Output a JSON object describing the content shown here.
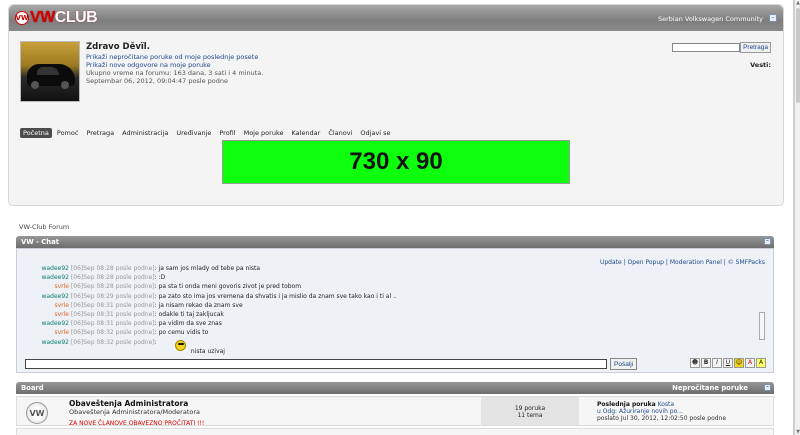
{
  "header": {
    "logo_left": "VW",
    "logo_right": "CLUB",
    "community": "Serbian Volkswagen Community"
  },
  "user": {
    "greeting": "Zdravo Děvïl.",
    "link_unread": "Prikaži nepročitane poruke od moje poslednje posete",
    "link_replies": "Prikaži nove odgovore na moje poruke",
    "time_online": "Ukupno vreme na forumu: 163 dana, 3 sati i 4 minuta.",
    "date": "Septembar 06, 2012, 09:04:47 posle podne"
  },
  "search": {
    "button": "Pretraga",
    "news_label": "Vesti:"
  },
  "menu": [
    "Početna",
    "Pomoć",
    "Pretraga",
    "Administracija",
    "Uređivanje",
    "Profil",
    "Moje poruke",
    "Kalendar",
    "Članovi",
    "Odjavi se"
  ],
  "banner": "730 x 90",
  "breadcrumb": "VW-Club Forum",
  "chat": {
    "title": "VW - Chat",
    "links": "Update | Open Popup | Moderation Panel | © SMFPacks",
    "send": "Pošalji",
    "format_buttons": [
      "☻",
      "B",
      "I",
      "U",
      "☺",
      "A",
      "A"
    ],
    "lines": [
      {
        "nick": "wadee92",
        "color": "teal",
        "ts": "[06]Sep 08:28 posle podne]",
        "msg": ": ja sam jos mlady od tebe pa nista"
      },
      {
        "nick": "wadee92",
        "color": "teal",
        "ts": "[06]Sep 08:28 posle podne]",
        "msg": ": :D"
      },
      {
        "nick": "svrle",
        "color": "orange",
        "ts": "[06]Sep 08:28 posle podne]",
        "msg": ": pa sta ti onda meni govoris zivot je pred tobom"
      },
      {
        "nick": "wadee92",
        "color": "teal",
        "ts": "[06]Sep 08:29 posle podne]",
        "msg": ": pa zato sto ima jos vremena da shvatis i ja mislio da znam sve tako kao i ti al .."
      },
      {
        "nick": "svrle",
        "color": "orange",
        "ts": "[06]Sep 08:31 posle podne]",
        "msg": ": ja nisam rekao da znam sve"
      },
      {
        "nick": "svrle",
        "color": "orange",
        "ts": "[06]Sep 08:31 posle podne]",
        "msg": ": odakle ti taj zakljucak"
      },
      {
        "nick": "wadee92",
        "color": "teal",
        "ts": "[06]Sep 08:31 posle podne]",
        "msg": ": pa vidim da sve znas"
      },
      {
        "nick": "svrle",
        "color": "orange",
        "ts": "[06]Sep 08:32 posle podne]",
        "msg": ": po cemu vidis to"
      },
      {
        "nick": "wadee92",
        "color": "teal",
        "ts": "[06]Sep 08:32 posle podne]",
        "msg": ":"
      },
      {
        "nick": "",
        "color": "teal",
        "ts": "",
        "msg": "nista uzivaj"
      }
    ]
  },
  "board": {
    "title": "Board",
    "unread": "Nepročitane poruke",
    "rows": [
      {
        "icon": "VW",
        "name": "Obaveštenja Administratora",
        "desc": "Obaveštenja Administratora/Moderatora",
        "note": "ZA NOVE ČLANOVE OBAVEZNO PROČITATI !!!",
        "posts": "19 poruka",
        "topics": "11 tema",
        "last_label": "Poslednja poruka",
        "last_by": "Kosta",
        "last_in": "u Odg: Ažuriranje novih po...",
        "last_date": "poslato Jul 30, 2012, 12:02:50 posle podne"
      }
    ]
  }
}
